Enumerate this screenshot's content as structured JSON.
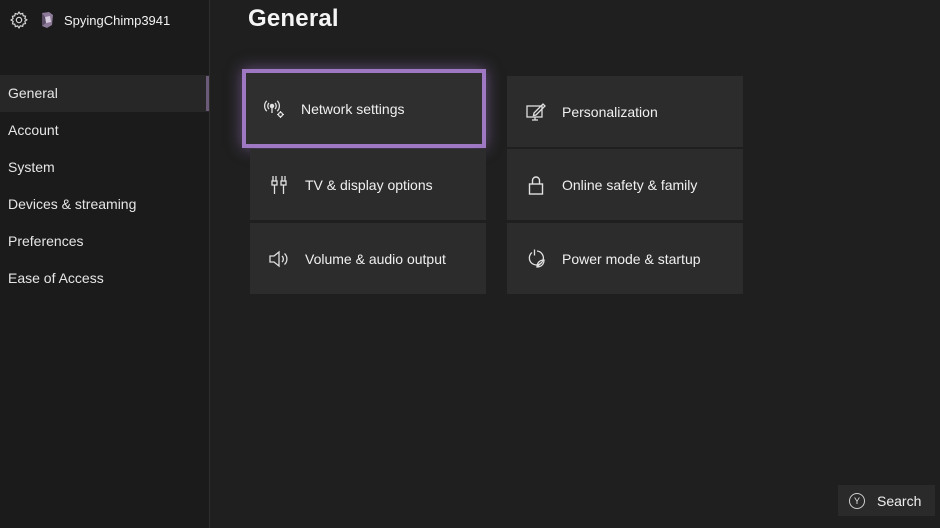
{
  "profile": {
    "gamertag": "SpyingChimp3941",
    "settings_icon": "gear-icon",
    "avatar_icon": "avatar-icon"
  },
  "page": {
    "title": "General"
  },
  "sidebar": {
    "items": [
      {
        "label": "General",
        "active": true
      },
      {
        "label": "Account",
        "active": false
      },
      {
        "label": "System",
        "active": false
      },
      {
        "label": "Devices & streaming",
        "active": false
      },
      {
        "label": "Preferences",
        "active": false
      },
      {
        "label": "Ease of Access",
        "active": false
      }
    ]
  },
  "tiles": [
    {
      "label": "Network settings",
      "icon": "network-icon",
      "focused": true
    },
    {
      "label": "Personalization",
      "icon": "personalization-icon",
      "focused": false
    },
    {
      "label": "TV & display options",
      "icon": "tv-display-icon",
      "focused": false
    },
    {
      "label": "Online safety & family",
      "icon": "lock-icon",
      "focused": false
    },
    {
      "label": "Volume & audio output",
      "icon": "speaker-icon",
      "focused": false
    },
    {
      "label": "Power mode & startup",
      "icon": "power-icon",
      "focused": false
    }
  ],
  "footer": {
    "search_button_glyph": "Y",
    "search_label": "Search"
  },
  "colors": {
    "focus_outline": "#9f78c4",
    "background": "#1f1f1f",
    "tile": "#2c2c2c"
  }
}
